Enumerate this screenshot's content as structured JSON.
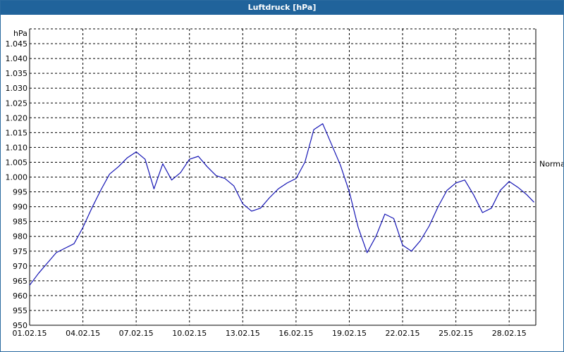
{
  "window": {
    "title": "Luftdruck [hPa]"
  },
  "chart_data": {
    "type": "line",
    "title": "Luftdruck [hPa]",
    "ylabel": "hPa",
    "xlabel": "",
    "ylim": [
      950,
      1050
    ],
    "y_ticks": [
      {
        "value": 950,
        "label": "950"
      },
      {
        "value": 955,
        "label": "955"
      },
      {
        "value": 960,
        "label": "960"
      },
      {
        "value": 965,
        "label": "965"
      },
      {
        "value": 970,
        "label": "970"
      },
      {
        "value": 975,
        "label": "975"
      },
      {
        "value": 980,
        "label": "980"
      },
      {
        "value": 985,
        "label": "985"
      },
      {
        "value": 990,
        "label": "990"
      },
      {
        "value": 995,
        "label": "995"
      },
      {
        "value": 1000,
        "label": "1.000"
      },
      {
        "value": 1005,
        "label": "1.005"
      },
      {
        "value": 1010,
        "label": "1.010"
      },
      {
        "value": 1015,
        "label": "1.015"
      },
      {
        "value": 1020,
        "label": "1.020"
      },
      {
        "value": 1025,
        "label": "1.025"
      },
      {
        "value": 1030,
        "label": "1.030"
      },
      {
        "value": 1035,
        "label": "1.035"
      },
      {
        "value": 1040,
        "label": "1.040"
      },
      {
        "value": 1045,
        "label": "1.045"
      }
    ],
    "x_ticks": [
      "01.02.15",
      "04.02.15",
      "07.02.15",
      "10.02.15",
      "13.02.15",
      "16.02.15",
      "19.02.15",
      "22.02.15",
      "25.02.15",
      "28.02.15"
    ],
    "grid": true,
    "reference_line": {
      "label": "Normal",
      "value": 1004.5
    },
    "line_color": "#1414b4",
    "series": [
      {
        "color": "#1414b4",
        "x_day": [
          1.0,
          1.5,
          2.0,
          2.5,
          3.0,
          3.5,
          4.0,
          4.5,
          5.0,
          5.5,
          6.0,
          6.5,
          7.0,
          7.5,
          8.0,
          8.5,
          9.0,
          9.5,
          10.0,
          10.5,
          11.0,
          11.5,
          12.0,
          12.5,
          13.0,
          13.5,
          14.0,
          14.5,
          15.0,
          15.5,
          16.0,
          16.5,
          17.0,
          17.5,
          18.0,
          18.5,
          19.0,
          19.5,
          20.0,
          20.5,
          21.0,
          21.5,
          22.0,
          22.5,
          23.0,
          23.5,
          24.0,
          24.5,
          25.0,
          25.5,
          26.0,
          26.5,
          27.0,
          27.5,
          28.0,
          28.5,
          29.0,
          29.4
        ],
        "values": [
          963.5,
          967.5,
          971.0,
          974.5,
          976.0,
          977.5,
          983.0,
          989.5,
          995.5,
          1001.0,
          1003.5,
          1006.5,
          1008.5,
          1006.0,
          996.0,
          1004.5,
          999.0,
          1001.5,
          1006.0,
          1007.0,
          1003.5,
          1000.5,
          999.5,
          997.0,
          991.0,
          988.5,
          989.5,
          993.0,
          996.0,
          998.0,
          999.5,
          1005.0,
          1016.0,
          1018.0,
          1011.0,
          1004.0,
          995.0,
          983.0,
          974.5,
          980.0,
          987.5,
          986.0,
          977.0,
          975.0,
          978.5,
          983.5,
          990.0,
          995.5,
          998.0,
          999.0,
          994.0,
          988.0,
          989.5,
          995.5,
          998.5,
          996.5,
          994.0,
          991.5
        ]
      }
    ]
  }
}
